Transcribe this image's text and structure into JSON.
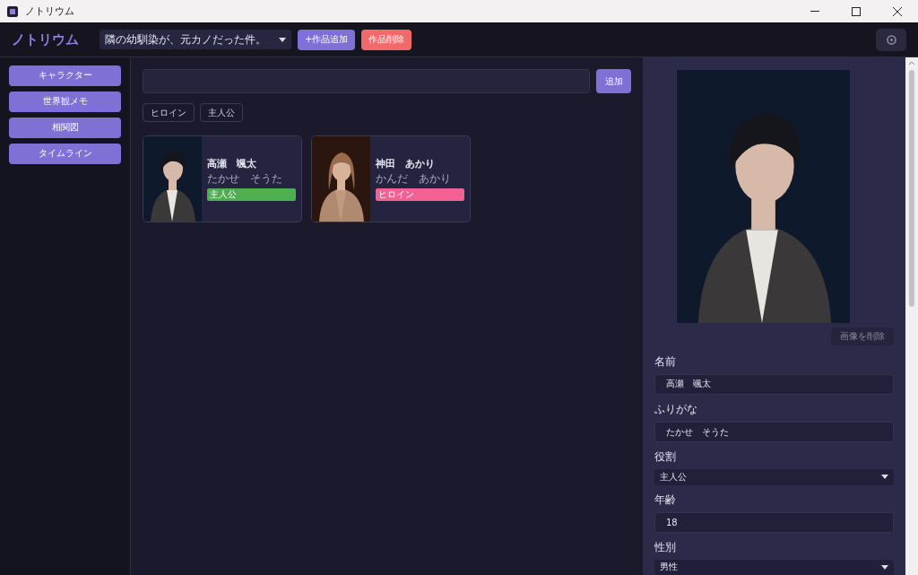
{
  "window": {
    "title": "ノトリウム"
  },
  "header": {
    "logo": "ノトリウム",
    "work_select": "隣の幼馴染が、元カノだった件。",
    "buttons": [
      {
        "label": "+作品追加",
        "kind": "primary"
      },
      {
        "label": "作品削除",
        "kind": "danger"
      }
    ]
  },
  "sidebar": {
    "items": [
      {
        "label": "キャラクター"
      },
      {
        "label": "世界観メモ"
      },
      {
        "label": "相関図"
      },
      {
        "label": "タイムライン"
      }
    ]
  },
  "tag_input": {
    "button": "追加"
  },
  "tags": [
    "ヒロイン",
    "主人公"
  ],
  "characters": [
    {
      "name": "高瀬　颯太",
      "furigana": "たかせ　そうた",
      "role": "主人公",
      "color": "#4caf50"
    },
    {
      "name": "神田　あかり",
      "furigana": "かんだ　あかり",
      "role": "ヒロイン",
      "color": "#f06292"
    }
  ],
  "detail": {
    "delete_image": "画像を削除",
    "fields": [
      {
        "label": "名前",
        "kind": "text",
        "value": "高瀬　颯太"
      },
      {
        "label": "ふりがな",
        "kind": "text",
        "value": "たかせ　そうた"
      },
      {
        "label": "役割",
        "kind": "select",
        "value": "主人公"
      },
      {
        "label": "年齢",
        "kind": "text",
        "value": "18"
      },
      {
        "label": "性別",
        "kind": "select",
        "value": "男性"
      }
    ]
  }
}
